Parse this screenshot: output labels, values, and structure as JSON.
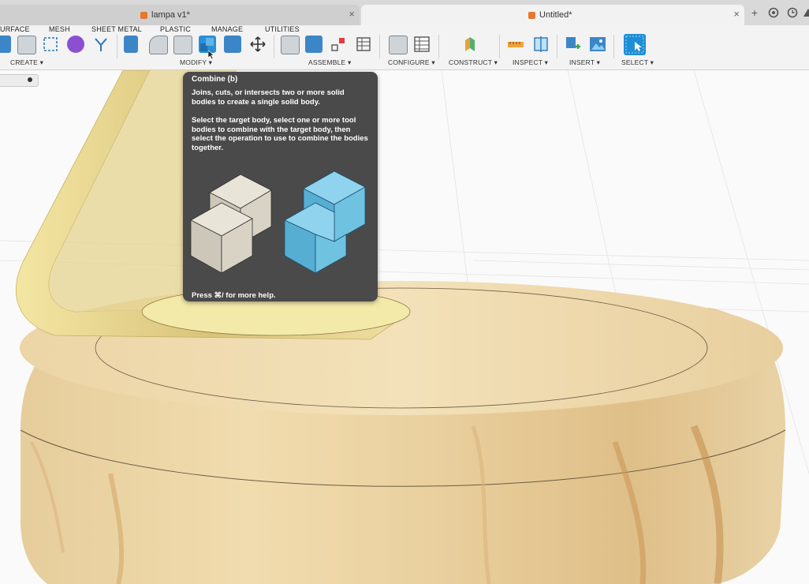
{
  "tabs": [
    {
      "label": "lampa v1*",
      "active": false,
      "close": "×"
    },
    {
      "label": "Untitled*",
      "active": true,
      "close": "×"
    }
  ],
  "tab_controls": {
    "add": "+"
  },
  "workspace_tabs": [
    "URFACE",
    "MESH",
    "SHEET METAL",
    "PLASTIC",
    "MANAGE",
    "UTILITIES"
  ],
  "groups": {
    "create": "CREATE ▾",
    "modify": "MODIFY ▾",
    "assemble": "ASSEMBLE ▾",
    "configure": "CONFIGURE ▾",
    "construct": "CONSTRUCT ▾",
    "inspect": "INSPECT ▾",
    "insert": "INSERT ▾",
    "select": "SELECT ▾"
  },
  "tooltip": {
    "title": "Combine (b)",
    "desc1": "Joins, cuts, or intersects two or more solid bodies to create a single solid body.",
    "desc2": "Select the target body, select one or more tool bodies to combine with the target body, then select the operation to use to combine the bodies together.",
    "footer": "Press ⌘/ for more help."
  },
  "colors": {
    "accent": "#1e8fd6",
    "tooltip_bg": "#4a4a4a",
    "wood": "#e9cf9d",
    "yellow_part": "#f0e6a6",
    "cube_grey": "#d6d0c4",
    "cube_blue": "#6fc2e0"
  }
}
